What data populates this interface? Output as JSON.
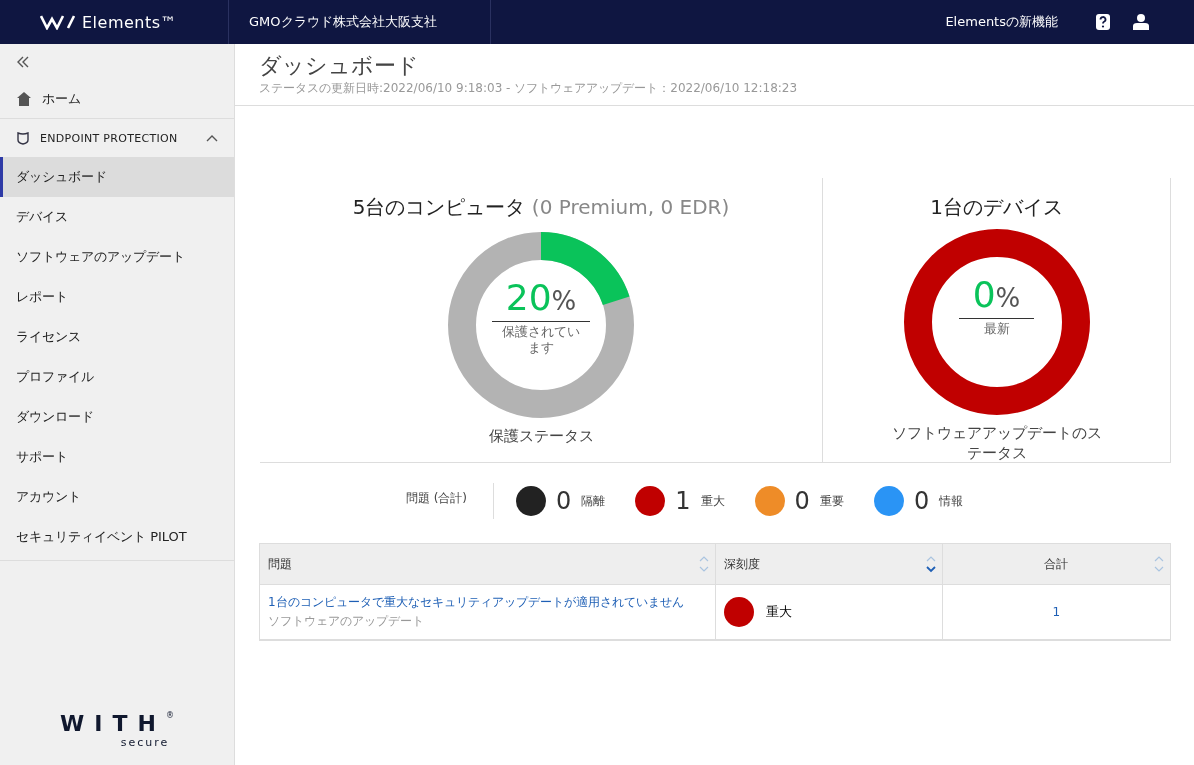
{
  "header": {
    "product": "Elements™",
    "company": "GMOクラウド株式会社大阪支社",
    "whats_new": "Elementsの新機能"
  },
  "sidebar": {
    "home": "ホーム",
    "section": {
      "title": "ENDPOINT PROTECTION",
      "expanded": true
    },
    "items": [
      {
        "label": "ダッシュボード",
        "selected": true
      },
      {
        "label": "デバイス",
        "selected": false
      },
      {
        "label": "ソフトウェアのアップデート",
        "selected": false
      },
      {
        "label": "レポート",
        "selected": false
      },
      {
        "label": "ライセンス",
        "selected": false
      },
      {
        "label": "プロファイル",
        "selected": false
      },
      {
        "label": "ダウンロード",
        "selected": false
      },
      {
        "label": "サポート",
        "selected": false
      },
      {
        "label": "アカウント",
        "selected": false
      },
      {
        "label": "セキュリティイベント PILOT",
        "selected": false
      }
    ],
    "logo": {
      "word": "WITH",
      "mark": "®",
      "sub": "secure"
    }
  },
  "page": {
    "title": "ダッシュボード",
    "subtitle": "ステータスの更新日時:2022/06/10 9:18:03 - ソフトウェアアップデート：2022/06/10 12:18:23"
  },
  "donuts": [
    {
      "kind": "protection",
      "title": "5台のコンピュータ",
      "title_note": "(0 Premium, 0 EDR)",
      "level": 0.2,
      "value": "20",
      "unit": "%",
      "center_label": "保護されています",
      "caption": "保護ステータス"
    },
    {
      "kind": "update",
      "title": "1台のデバイス",
      "level": 0,
      "value": "0",
      "unit": "%",
      "center_label": "最新",
      "caption": "ソフトウェアアップデートのステータス"
    }
  ],
  "issues_summary": {
    "label": "問題 (合計)",
    "counts": [
      {
        "count": "0",
        "label": "隔離",
        "color": "#222222"
      },
      {
        "count": "1",
        "label": "重大",
        "color": "#c00000"
      },
      {
        "count": "0",
        "label": "重要",
        "color": "#ee8c28"
      },
      {
        "count": "0",
        "label": "情報",
        "color": "#2a94f5"
      }
    ]
  },
  "table": {
    "columns": [
      {
        "label": "問題",
        "sorted": false
      },
      {
        "label": "深刻度",
        "sorted": true
      },
      {
        "label": "合計",
        "sorted": false
      }
    ],
    "rows": [
      {
        "issue": "1台のコンピュータで重大なセキュリティアップデートが適用されていません",
        "category": "ソフトウェアのアップデート",
        "severity": "重大",
        "color": "#c00000",
        "total": "1"
      }
    ]
  }
}
